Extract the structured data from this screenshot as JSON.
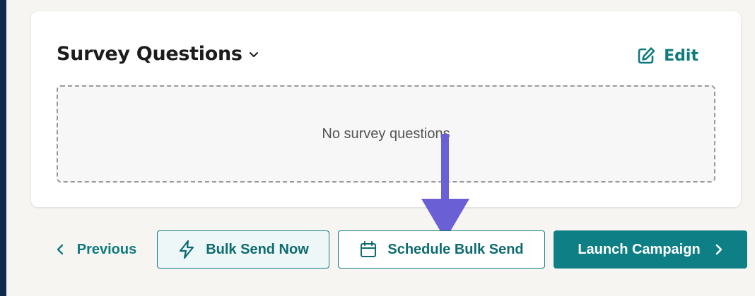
{
  "survey": {
    "title": "Survey Questions",
    "edit_label": "Edit",
    "empty_text": "No survey questions"
  },
  "footer": {
    "previous_label": "Previous",
    "bulk_send_now_label": "Bulk Send Now",
    "schedule_bulk_send_label": "Schedule Bulk Send",
    "launch_campaign_label": "Launch Campaign"
  },
  "icons": {
    "title_dropdown": "chevron-down-icon",
    "edit": "edit-icon",
    "previous": "chevron-left-icon",
    "bulk_send_now": "lightning-icon",
    "schedule": "calendar-icon",
    "launch": "chevron-right-icon"
  },
  "colors": {
    "accent": "#0e7a7f",
    "annotation_arrow": "#6b5fd6",
    "sidebar": "#0f2a4d"
  }
}
